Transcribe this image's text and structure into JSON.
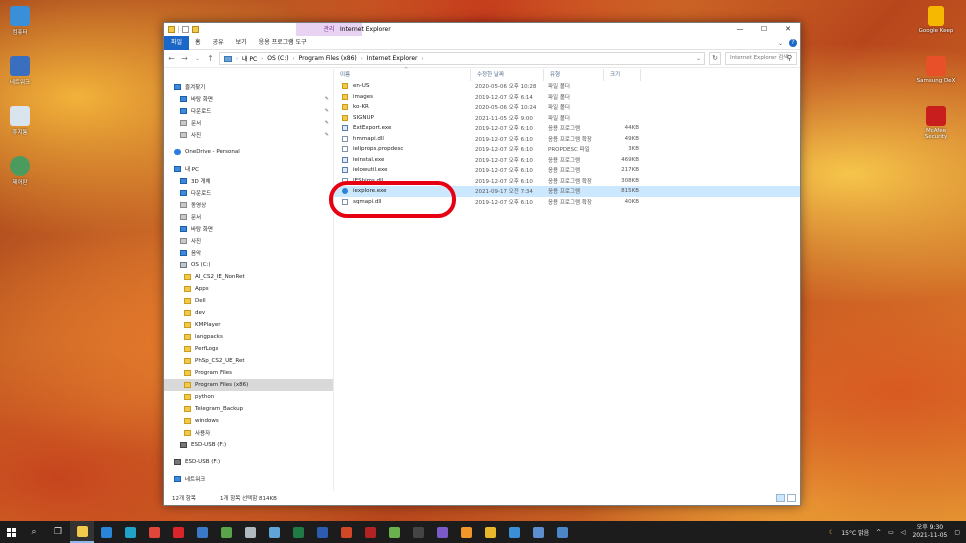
{
  "desktop": {
    "icons": [
      {
        "label": "컴퓨터",
        "color": "#3a8fd8"
      },
      {
        "label": "네트워크",
        "color": "#3a6fc0"
      },
      {
        "label": "휴지통",
        "color": "#d9e4ee"
      },
      {
        "label": "제어판",
        "color": "#4c9b5e"
      },
      {
        "label": "Google Keep",
        "color": "#f6b800"
      },
      {
        "label": "Samsung DeX",
        "color": "#e8502a"
      },
      {
        "label": "McAfee Security",
        "color": "#c81e1e"
      }
    ]
  },
  "window": {
    "title": "Internet Explorer",
    "context_tab": "관리",
    "buttons": {
      "minimize": "—",
      "maximize": "☐",
      "close": "✕"
    },
    "ribbon_tabs": [
      "파일",
      "홈",
      "공유",
      "보기",
      "응용 프로그램 도구"
    ],
    "address": {
      "crumbs": [
        "내 PC",
        "OS (C:)",
        "Program Files (x86)",
        "Internet Explorer"
      ]
    },
    "search_placeholder": "Internet Explorer 검색",
    "columns": [
      "이름",
      "수정한 날짜",
      "유형",
      "크기"
    ],
    "files": [
      {
        "name": "en-US",
        "date": "2020-05-06 오후 10:28",
        "type": "파일 폴더",
        "size": "",
        "kind": "folder"
      },
      {
        "name": "images",
        "date": "2019-12-07 오후 6:14",
        "type": "파일 폴더",
        "size": "",
        "kind": "folder"
      },
      {
        "name": "ko-KR",
        "date": "2020-05-06 오후 10:24",
        "type": "파일 폴더",
        "size": "",
        "kind": "folder"
      },
      {
        "name": "SIGNUP",
        "date": "2021-11-05 오후 9:00",
        "type": "파일 폴더",
        "size": "",
        "kind": "folder"
      },
      {
        "name": "ExtExport.exe",
        "date": "2019-12-07 오후 6:10",
        "type": "응용 프로그램",
        "size": "44KB",
        "kind": "exe"
      },
      {
        "name": "hmmapi.dll",
        "date": "2019-12-07 오후 6:10",
        "type": "응용 프로그램 확장",
        "size": "49KB",
        "kind": "file"
      },
      {
        "name": "ieIiprops.propdesc",
        "date": "2019-12-07 오후 6:10",
        "type": "PROPDESC 파일",
        "size": "3KB",
        "kind": "file"
      },
      {
        "name": "ieinstal.exe",
        "date": "2019-12-07 오후 6:10",
        "type": "응용 프로그램",
        "size": "469KB",
        "kind": "exe"
      },
      {
        "name": "ielowutil.exe",
        "date": "2019-12-07 오후 6:10",
        "type": "응용 프로그램",
        "size": "217KB",
        "kind": "exe"
      },
      {
        "name": "IEShims.dll",
        "date": "2019-12-07 오후 6:10",
        "type": "응용 프로그램 확장",
        "size": "308KB",
        "kind": "file"
      },
      {
        "name": "iexplore.exe",
        "date": "2021-09-17 오전 7:34",
        "type": "응용 프로그램",
        "size": "815KB",
        "kind": "ie",
        "selected": true
      },
      {
        "name": "sqmapi.dll",
        "date": "2019-12-07 오후 6:10",
        "type": "응용 프로그램 확장",
        "size": "40KB",
        "kind": "file"
      }
    ],
    "sidebar": [
      {
        "label": "즐겨찾기",
        "indent": 10,
        "icon": "blue"
      },
      {
        "label": "바탕 화면",
        "indent": 16,
        "icon": "blue",
        "pin": true
      },
      {
        "label": "다운로드",
        "indent": 16,
        "icon": "blue",
        "pin": true
      },
      {
        "label": "문서",
        "indent": 16,
        "icon": "grey",
        "pin": true
      },
      {
        "label": "사진",
        "indent": 16,
        "icon": "grey",
        "pin": true
      },
      {
        "label": "",
        "indent": 0,
        "icon": ""
      },
      {
        "label": "OneDrive - Personal",
        "indent": 10,
        "icon": "cloud"
      },
      {
        "label": "",
        "indent": 0,
        "icon": ""
      },
      {
        "label": "내 PC",
        "indent": 10,
        "icon": "blue"
      },
      {
        "label": "3D 개체",
        "indent": 16,
        "icon": "blue"
      },
      {
        "label": "다운로드",
        "indent": 16,
        "icon": "blue"
      },
      {
        "label": "동영상",
        "indent": 16,
        "icon": "grey"
      },
      {
        "label": "문서",
        "indent": 16,
        "icon": "grey"
      },
      {
        "label": "바탕 화면",
        "indent": 16,
        "icon": "blue"
      },
      {
        "label": "사진",
        "indent": 16,
        "icon": "grey"
      },
      {
        "label": "음악",
        "indent": 16,
        "icon": "blue"
      },
      {
        "label": "OS (C:)",
        "indent": 16,
        "icon": "drive"
      },
      {
        "label": "AI_CS2_IE_NonRet",
        "indent": 20,
        "icon": "fold"
      },
      {
        "label": "Apps",
        "indent": 20,
        "icon": "fold"
      },
      {
        "label": "Dell",
        "indent": 20,
        "icon": "fold"
      },
      {
        "label": "dev",
        "indent": 20,
        "icon": "fold"
      },
      {
        "label": "KMPlayer",
        "indent": 20,
        "icon": "fold"
      },
      {
        "label": "langpacks",
        "indent": 20,
        "icon": "fold"
      },
      {
        "label": "PerfLogs",
        "indent": 20,
        "icon": "fold"
      },
      {
        "label": "PhSp_CS2_UE_Ret",
        "indent": 20,
        "icon": "fold"
      },
      {
        "label": "Program Files",
        "indent": 20,
        "icon": "fold"
      },
      {
        "label": "Program Files (x86)",
        "indent": 20,
        "icon": "fold",
        "selected": true
      },
      {
        "label": "python",
        "indent": 20,
        "icon": "fold"
      },
      {
        "label": "Telegram_Backup",
        "indent": 20,
        "icon": "fold"
      },
      {
        "label": "windows",
        "indent": 20,
        "icon": "fold"
      },
      {
        "label": "사용자",
        "indent": 20,
        "icon": "fold"
      },
      {
        "label": "ESD-USB (F:)",
        "indent": 16,
        "icon": "usb"
      },
      {
        "label": "",
        "indent": 0,
        "icon": ""
      },
      {
        "label": "ESD-USB (F:)",
        "indent": 10,
        "icon": "usb"
      },
      {
        "label": "",
        "indent": 0,
        "icon": ""
      },
      {
        "label": "네트워크",
        "indent": 10,
        "icon": "blue"
      }
    ],
    "status": {
      "count": "12개 항목",
      "selection": "1개 항목 선택함 814KB"
    }
  },
  "taskbar": {
    "apps": [
      {
        "name": "search",
        "glyph": "⌕",
        "color": ""
      },
      {
        "name": "task-view",
        "glyph": "❐",
        "color": ""
      },
      {
        "name": "file-explorer",
        "glyph": "",
        "color": "#f3c94a",
        "active": true
      },
      {
        "name": "mail",
        "glyph": "",
        "color": "#2a84d8"
      },
      {
        "name": "edge",
        "glyph": "",
        "color": "#1fa3c9"
      },
      {
        "name": "chrome",
        "glyph": "",
        "color": "#e0463a"
      },
      {
        "name": "opera",
        "glyph": "",
        "color": "#d9252a"
      },
      {
        "name": "app-photo",
        "glyph": "",
        "color": "#3a78c8"
      },
      {
        "name": "app-puzzle",
        "glyph": "",
        "color": "#59a44a"
      },
      {
        "name": "app-grey",
        "glyph": "",
        "color": "#b0b8c0"
      },
      {
        "name": "notepad",
        "glyph": "",
        "color": "#5fa5d8"
      },
      {
        "name": "excel",
        "glyph": "",
        "color": "#1f7a44"
      },
      {
        "name": "word",
        "glyph": "",
        "color": "#2b5caf"
      },
      {
        "name": "powerpoint",
        "glyph": "",
        "color": "#d24726"
      },
      {
        "name": "app-red",
        "glyph": "",
        "color": "#b42222"
      },
      {
        "name": "app-leaf",
        "glyph": "",
        "color": "#6ab04c"
      },
      {
        "name": "app-dark",
        "glyph": "",
        "color": "#444"
      },
      {
        "name": "app-browser2",
        "glyph": "",
        "color": "#7a5ac8"
      },
      {
        "name": "app-orange",
        "glyph": "",
        "color": "#f2962a"
      },
      {
        "name": "app-yellow",
        "glyph": "",
        "color": "#e8b82a"
      },
      {
        "name": "app-blue2",
        "glyph": "",
        "color": "#3a8fd8"
      },
      {
        "name": "app-bluegrid",
        "glyph": "",
        "color": "#5c8fd0"
      },
      {
        "name": "app-doc",
        "glyph": "",
        "color": "#4a86c8"
      }
    ],
    "weather": "15°C 맑음",
    "time": "오후 9:30",
    "date": "2021-11-05"
  }
}
